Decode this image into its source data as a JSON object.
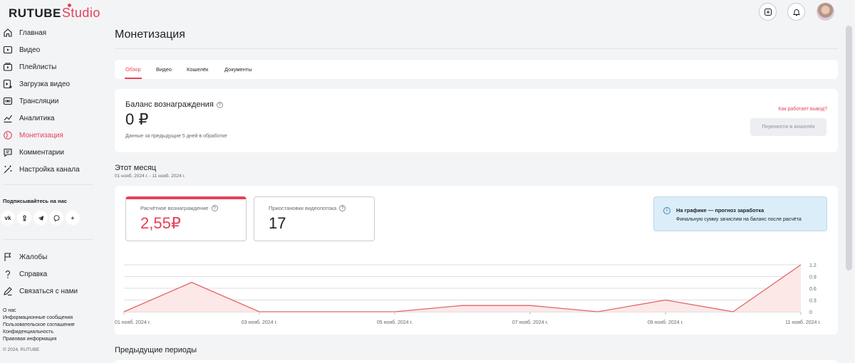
{
  "app": {
    "logo_text": "RUTUBE",
    "logo_suffix": "Studio",
    "avatar": "user-avatar"
  },
  "topbar": {
    "icons": [
      "add-video-icon",
      "bell-icon"
    ]
  },
  "sidebar": {
    "items": [
      {
        "label": "Главная",
        "icon": "home-icon"
      },
      {
        "label": "Видео",
        "icon": "video-icon"
      },
      {
        "label": "Плейлисты",
        "icon": "playlist-icon"
      },
      {
        "label": "Загрузка видео",
        "icon": "upload-icon"
      },
      {
        "label": "Трансляции",
        "icon": "live-icon"
      },
      {
        "label": "Аналитика",
        "icon": "analytics-icon"
      },
      {
        "label": "Монетизация",
        "icon": "monetization-icon",
        "active": true
      },
      {
        "label": "Комментарии",
        "icon": "comments-icon"
      },
      {
        "label": "Настройка канала",
        "icon": "magic-wand-icon"
      }
    ],
    "subscribe_title": "Подписывайтесь на нас",
    "socials": [
      {
        "label": "vk",
        "icon": "vk-icon"
      },
      {
        "label": "ok",
        "icon": "ok-icon"
      },
      {
        "label": "tg",
        "icon": "telegram-icon"
      },
      {
        "label": "viber",
        "icon": "viber-icon"
      },
      {
        "label": "+",
        "icon": "more-icon"
      }
    ],
    "bottom_items": [
      {
        "label": "Жалобы",
        "icon": "flag-icon"
      },
      {
        "label": "Справка",
        "icon": "help-icon"
      },
      {
        "label": "Связаться с нами",
        "icon": "contact-icon"
      }
    ],
    "footer_links": [
      "О нас",
      "Информационные сообщения",
      "Пользовательское соглашение",
      "Конфиденциальность",
      "Правовая информация"
    ],
    "copyright": "© 2024, RUTUBE"
  },
  "main": {
    "title": "Монетизация",
    "tabs": [
      {
        "label": "Обзор",
        "active": true
      },
      {
        "label": "Видео"
      },
      {
        "label": "Кошелёк"
      },
      {
        "label": "Документы"
      }
    ],
    "balance": {
      "title": "Баланс вознаграждения",
      "value": "0 ₽",
      "note": "Данные за предыдущие 5 дней в обработке",
      "how_link": "Как работает вывод?",
      "transfer_button": "Перенести в кошелёк"
    },
    "month": {
      "title": "Этот месяц",
      "range": "01 нояб. 2024 г. - 11 нояб. 2024 г."
    },
    "stats": [
      {
        "label": "Расчётное вознаграждение",
        "value": "2,55₽",
        "active": true
      },
      {
        "label": "Приостановки видеопотока",
        "value": "17"
      }
    ],
    "info": {
      "title": "На графике — прогноз заработка",
      "text": "Финальную сумму зачислим на баланс после расчёта"
    },
    "previous_title": "Предыдущие периоды"
  },
  "chart_data": {
    "type": "area",
    "x": [
      "01 нояб. 2024 г.",
      "02 нояб. 2024 г.",
      "03 нояб. 2024 г.",
      "04 нояб. 2024 г.",
      "05 нояб. 2024 г.",
      "06 нояб. 2024 г.",
      "07 нояб. 2024 г.",
      "08 нояб. 2024 г.",
      "09 нояб. 2024 г.",
      "10 нояб. 2024 г.",
      "11 нояб. 2024 г."
    ],
    "x_tick_labels": [
      "01 нояб. 2024 г.",
      "03 нояб. 2024 г.",
      "05 нояб. 2024 г.",
      "07 нояб. 2024 г.",
      "09 нояб. 2024 г.",
      "11 нояб. 2024 г."
    ],
    "values": [
      0,
      0.75,
      0,
      0,
      0,
      0.16,
      0.16,
      0,
      0.3,
      0,
      1.2
    ],
    "y_ticks": [
      "1.2",
      "0.9",
      "0.6",
      "0.3",
      "0"
    ],
    "ylim": [
      0,
      1.2
    ],
    "y_axis_position": "right",
    "grid": true,
    "line_color": "#e06666",
    "fill_color": "#fde8e8"
  }
}
